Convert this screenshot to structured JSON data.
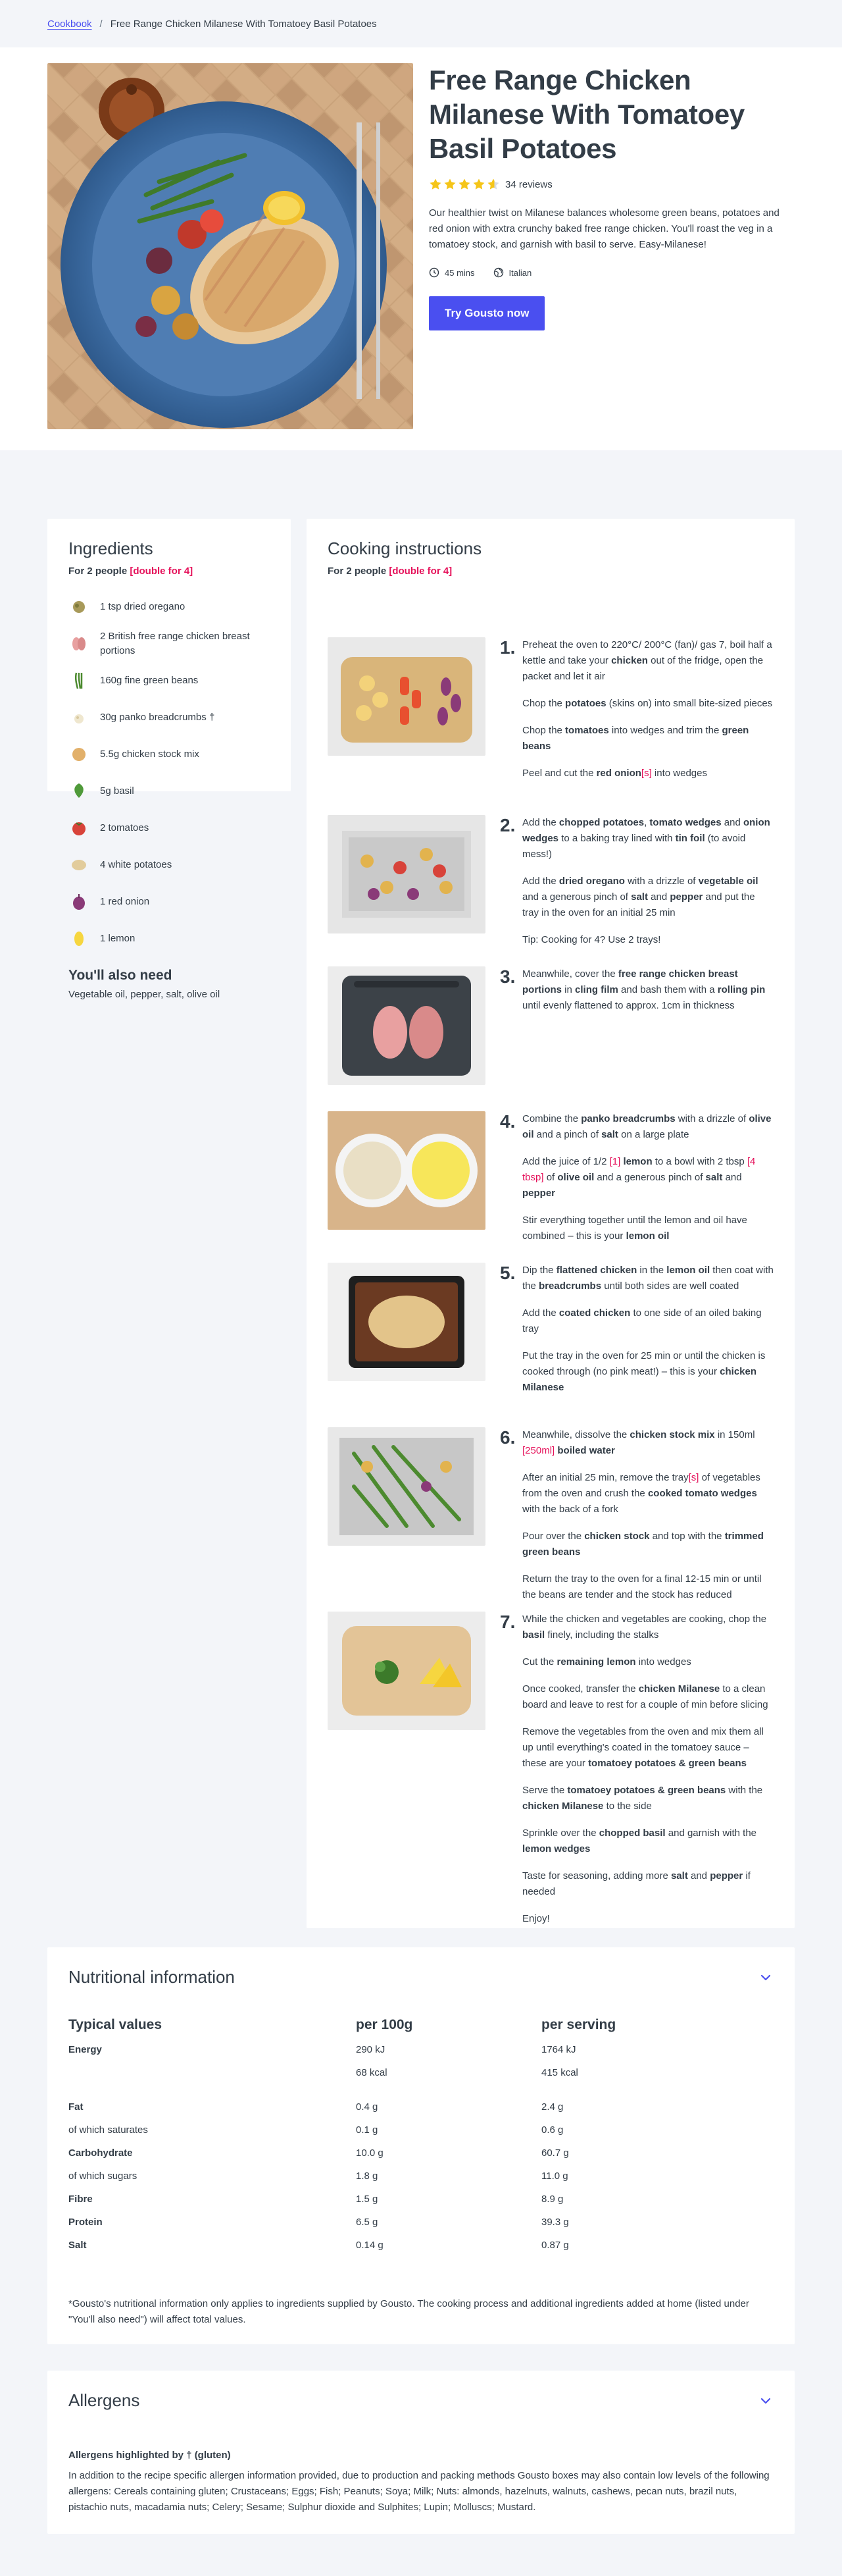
{
  "breadcrumb": {
    "root": "Cookbook",
    "separator": "/",
    "current": "Free Range Chicken Milanese With Tomatoey Basil Potatoes"
  },
  "recipe": {
    "title": "Free Range Chicken Milanese With Tomatoey Basil Potatoes",
    "rating": 4.6,
    "reviews": "34 reviews",
    "description": "Our healthier twist on Milanese balances wholesome green beans, potatoes and red onion with extra crunchy baked free range chicken. You'll roast the veg in a tomatoey stock, and garnish with basil to serve. Easy-Milanese!",
    "time": "45 mins",
    "cuisine": "Italian",
    "cta": "Try Gousto now"
  },
  "ingredients": {
    "heading": "Ingredients",
    "serves": "For 2 people",
    "double": "[double for 4]",
    "items": [
      {
        "icon": "oregano-icon",
        "label": "1 tsp dried oregano"
      },
      {
        "icon": "chicken-breast-icon",
        "label": "2 British free range chicken breast portions"
      },
      {
        "icon": "green-beans-icon",
        "label": "160g fine green beans"
      },
      {
        "icon": "breadcrumbs-icon",
        "label": "30g panko breadcrumbs †"
      },
      {
        "icon": "stock-icon",
        "label": "5.5g chicken stock mix"
      },
      {
        "icon": "basil-icon",
        "label": "5g basil"
      },
      {
        "icon": "tomato-icon",
        "label": "2 tomatoes"
      },
      {
        "icon": "potato-icon",
        "label": "4 white potatoes"
      },
      {
        "icon": "red-onion-icon",
        "label": "1 red onion"
      },
      {
        "icon": "lemon-icon",
        "label": "1 lemon"
      }
    ],
    "also_heading": "You'll also need",
    "also_text": "Vegetable oil, pepper, salt, olive oil"
  },
  "cooking": {
    "heading": "Cooking instructions",
    "serves": "For 2 people",
    "double": "[double for 4]",
    "steps": [
      {
        "num": "1.",
        "paragraphs": [
          [
            {
              "t": "Preheat the oven to 220°C/ 200°C (fan)/ gas 7, boil half a kettle and take your "
            },
            {
              "t": "chicken",
              "b": true
            },
            {
              "t": " out of the fridge, open the packet and let it air"
            }
          ],
          [
            {
              "t": "Chop the "
            },
            {
              "t": "potatoes",
              "b": true
            },
            {
              "t": " (skins on) into small bite-sized pieces"
            }
          ],
          [
            {
              "t": "Chop the "
            },
            {
              "t": "tomatoes",
              "b": true
            },
            {
              "t": " into wedges and trim the "
            },
            {
              "t": "green beans",
              "b": true
            }
          ],
          [
            {
              "t": "Peel and cut the "
            },
            {
              "t": "red onion",
              "b": true
            },
            {
              "t": "[s]",
              "h": true
            },
            {
              "t": " into wedges"
            }
          ]
        ]
      },
      {
        "num": "2.",
        "paragraphs": [
          [
            {
              "t": "Add the "
            },
            {
              "t": "chopped potatoes",
              "b": true
            },
            {
              "t": ", "
            },
            {
              "t": "tomato wedges",
              "b": true
            },
            {
              "t": " and "
            },
            {
              "t": "onion wedges",
              "b": true
            },
            {
              "t": " to a baking tray lined with "
            },
            {
              "t": "tin foil",
              "b": true
            },
            {
              "t": " (to avoid mess!)"
            }
          ],
          [
            {
              "t": "Add the "
            },
            {
              "t": "dried oregano",
              "b": true
            },
            {
              "t": " with a drizzle of "
            },
            {
              "t": "vegetable oil",
              "b": true
            },
            {
              "t": " and a generous pinch of "
            },
            {
              "t": "salt",
              "b": true
            },
            {
              "t": " and "
            },
            {
              "t": "pepper",
              "b": true
            },
            {
              "t": " and put the tray in the oven for an initial 25 min"
            }
          ],
          [
            {
              "t": "Tip: Cooking for 4? Use 2 trays!"
            }
          ]
        ]
      },
      {
        "num": "3.",
        "paragraphs": [
          [
            {
              "t": "Meanwhile, cover the "
            },
            {
              "t": "free range chicken breast portions",
              "b": true
            },
            {
              "t": " in "
            },
            {
              "t": "cling film",
              "b": true
            },
            {
              "t": " and bash them with a "
            },
            {
              "t": "rolling pin",
              "b": true
            },
            {
              "t": " until evenly flattened to approx. 1cm in thickness"
            }
          ]
        ]
      },
      {
        "num": "4.",
        "paragraphs": [
          [
            {
              "t": "Combine the "
            },
            {
              "t": "panko breadcrumbs",
              "b": true
            },
            {
              "t": " with a drizzle of "
            },
            {
              "t": "olive oil",
              "b": true
            },
            {
              "t": " and a pinch of "
            },
            {
              "t": "salt",
              "b": true
            },
            {
              "t": " on a large plate"
            }
          ],
          [
            {
              "t": "Add the juice of 1/2 "
            },
            {
              "t": "[1]",
              "h": true
            },
            {
              "t": " "
            },
            {
              "t": "lemon",
              "b": true
            },
            {
              "t": " to a bowl with 2 tbsp "
            },
            {
              "t": "[4 tbsp]",
              "h": true
            },
            {
              "t": " of "
            },
            {
              "t": "olive oil",
              "b": true
            },
            {
              "t": " and a generous pinch of "
            },
            {
              "t": "salt",
              "b": true
            },
            {
              "t": " and "
            },
            {
              "t": "pepper",
              "b": true
            }
          ],
          [
            {
              "t": "Stir everything together until the lemon and oil have combined – this is your "
            },
            {
              "t": "lemon oil",
              "b": true
            }
          ]
        ]
      },
      {
        "num": "5.",
        "paragraphs": [
          [
            {
              "t": "Dip the "
            },
            {
              "t": "flattened chicken",
              "b": true
            },
            {
              "t": " in the "
            },
            {
              "t": "lemon oil",
              "b": true
            },
            {
              "t": " then coat with the "
            },
            {
              "t": "breadcrumbs",
              "b": true
            },
            {
              "t": " until both sides are well coated"
            }
          ],
          [
            {
              "t": "Add the "
            },
            {
              "t": "coated chicken",
              "b": true
            },
            {
              "t": " to one side of an oiled baking tray"
            }
          ],
          [
            {
              "t": "Put the tray in the oven for 25 min or until the chicken is cooked through (no pink meat!) – this is your "
            },
            {
              "t": "chicken Milanese",
              "b": true
            }
          ]
        ]
      },
      {
        "num": "6.",
        "paragraphs": [
          [
            {
              "t": "Meanwhile, dissolve the "
            },
            {
              "t": "chicken stock mix",
              "b": true
            },
            {
              "t": " in 150ml "
            },
            {
              "t": "[250ml]",
              "h": true
            },
            {
              "t": " "
            },
            {
              "t": "boiled water",
              "b": true
            }
          ],
          [
            {
              "t": "After an initial 25 min, remove the tray"
            },
            {
              "t": "[s]",
              "h": true
            },
            {
              "t": " of vegetables from the oven and crush the "
            },
            {
              "t": "cooked tomato wedges",
              "b": true
            },
            {
              "t": " with the back of a fork"
            }
          ],
          [
            {
              "t": "Pour over the "
            },
            {
              "t": "chicken stock",
              "b": true
            },
            {
              "t": " and top with the "
            },
            {
              "t": "trimmed green beans",
              "b": true
            }
          ],
          [
            {
              "t": "Return the tray to the oven for a final 12-15 min or until the beans are tender and the stock has reduced"
            }
          ]
        ]
      },
      {
        "num": "7.",
        "paragraphs": [
          [
            {
              "t": "While the chicken and vegetables are cooking, chop the "
            },
            {
              "t": "basil",
              "b": true
            },
            {
              "t": " finely, including the stalks"
            }
          ],
          [
            {
              "t": "Cut the "
            },
            {
              "t": "remaining lemon",
              "b": true
            },
            {
              "t": " into wedges"
            }
          ],
          [
            {
              "t": "Once cooked, transfer the "
            },
            {
              "t": "chicken Milanese",
              "b": true
            },
            {
              "t": " to a clean board and leave to rest for a couple of min before slicing"
            }
          ],
          [
            {
              "t": "Remove the vegetables from the oven and mix them all up until everything's coated in the tomatoey sauce – these are your "
            },
            {
              "t": "tomatoey potatoes & green beans",
              "b": true
            }
          ],
          [
            {
              "t": "Serve the "
            },
            {
              "t": "tomatoey potatoes & green beans",
              "b": true
            },
            {
              "t": " with the "
            },
            {
              "t": "chicken Milanese",
              "b": true
            },
            {
              "t": " to the side"
            }
          ],
          [
            {
              "t": "Sprinkle over the "
            },
            {
              "t": "chopped basil",
              "b": true
            },
            {
              "t": " and garnish with the "
            },
            {
              "t": "lemon wedges",
              "b": true
            }
          ],
          [
            {
              "t": "Taste for seasoning, adding more "
            },
            {
              "t": "salt",
              "b": true
            },
            {
              "t": " and "
            },
            {
              "t": "pepper",
              "b": true
            },
            {
              "t": " if needed"
            }
          ],
          [
            {
              "t": "Enjoy!"
            }
          ]
        ]
      }
    ]
  },
  "nutrition": {
    "heading": "Nutritional information",
    "columns": [
      "Typical values",
      "per 100g",
      "per serving"
    ],
    "rows": [
      {
        "label": "Energy",
        "bold": true,
        "per100": "290 kJ",
        "serving": "1764 kJ"
      },
      {
        "label": "",
        "bold": false,
        "per100": "68 kcal",
        "serving": "415 kcal"
      },
      {
        "label": "Fat",
        "bold": true,
        "per100": "0.4 g",
        "serving": "2.4 g",
        "gap": true
      },
      {
        "label": "of which saturates",
        "bold": false,
        "per100": "0.1 g",
        "serving": "0.6 g"
      },
      {
        "label": "Carbohydrate",
        "bold": true,
        "per100": "10.0 g",
        "serving": "60.7 g"
      },
      {
        "label": "of which sugars",
        "bold": false,
        "per100": "1.8 g",
        "serving": "11.0 g"
      },
      {
        "label": "Fibre",
        "bold": true,
        "per100": "1.5 g",
        "serving": "8.9 g"
      },
      {
        "label": "Protein",
        "bold": true,
        "per100": "6.5 g",
        "serving": "39.3 g"
      },
      {
        "label": "Salt",
        "bold": true,
        "per100": "0.14 g",
        "serving": "0.87 g"
      }
    ],
    "note": "*Gousto's nutritional information only applies to ingredients supplied by Gousto. The cooking process and additional ingredients added at home (listed under \"You'll also need\") will affect total values."
  },
  "allergens": {
    "heading": "Allergens",
    "sub": "Allergens highlighted by † (gluten)",
    "text": "In addition to the recipe specific allergen information provided, due to production and packing methods Gousto boxes may also contain low levels of the following allergens: Cereals containing gluten; Crustaceans; Eggs; Fish; Peanuts; Soya; Milk; Nuts: almonds, hazelnuts, walnuts, cashews, pecan nuts, brazil nuts, pistachio nuts, macadamia nuts; Celery; Sesame; Sulphur dioxide and Sulphites; Lupin; Molluscs; Mustard."
  },
  "colors": {
    "accent": "#4a4ff0",
    "highlight": "#e5115a",
    "star": "#f5c518",
    "page_bg": "#f3f5f9"
  }
}
